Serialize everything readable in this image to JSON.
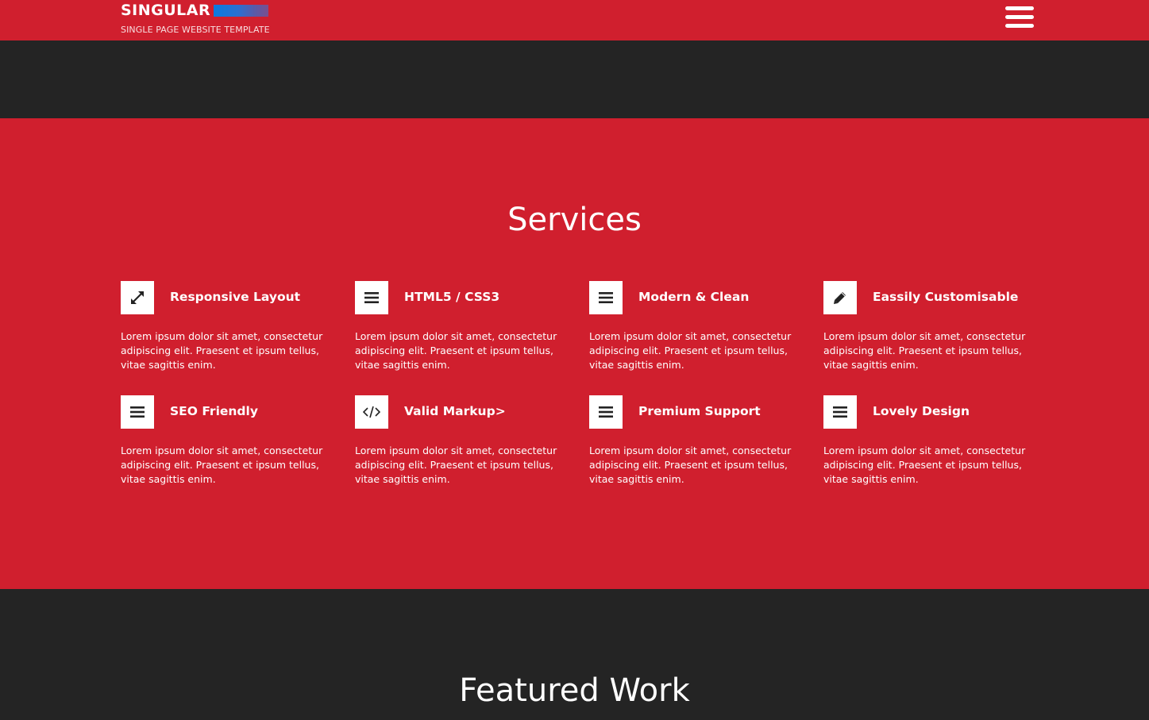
{
  "header": {
    "brand_name": "SINGULAR",
    "tagline": "SINGLE PAGE WEBSITE TEMPLATE",
    "menu_icon": "hamburger-menu-icon"
  },
  "colors": {
    "accent_red": "#d01f2e",
    "dark": "#242424",
    "white": "#ffffff"
  },
  "services": {
    "title": "Services",
    "items": [
      {
        "icon": "expand-arrows-icon",
        "title": "Responsive Layout",
        "text": "Lorem ipsum dolor sit amet, consectetur adipiscing elit. Praesent et ipsum tellus, vitae sagittis enim."
      },
      {
        "icon": "list-icon",
        "title": "HTML5 / CSS3",
        "text": "Lorem ipsum dolor sit amet, consectetur adipiscing elit. Praesent et ipsum tellus, vitae sagittis enim."
      },
      {
        "icon": "list-icon",
        "title": "Modern & Clean",
        "text": "Lorem ipsum dolor sit amet, consectetur adipiscing elit. Praesent et ipsum tellus, vitae sagittis enim."
      },
      {
        "icon": "pencil-icon",
        "title": "Eassily Customisable",
        "text": "Lorem ipsum dolor sit amet, consectetur adipiscing elit. Praesent et ipsum tellus, vitae sagittis enim."
      },
      {
        "icon": "list-icon",
        "title": "SEO Friendly",
        "text": "Lorem ipsum dolor sit amet, consectetur adipiscing elit. Praesent et ipsum tellus, vitae sagittis enim."
      },
      {
        "icon": "code-icon",
        "title": "Valid Markup>",
        "text": "Lorem ipsum dolor sit amet, consectetur adipiscing elit. Praesent et ipsum tellus, vitae sagittis enim."
      },
      {
        "icon": "list-icon",
        "title": "Premium Support",
        "text": "Lorem ipsum dolor sit amet, consectetur adipiscing elit. Praesent et ipsum tellus, vitae sagittis enim."
      },
      {
        "icon": "list-icon",
        "title": "Lovely Design",
        "text": "Lorem ipsum dolor sit amet, consectetur adipiscing elit. Praesent et ipsum tellus, vitae sagittis enim."
      }
    ]
  },
  "featured": {
    "title": "Featured Work"
  }
}
